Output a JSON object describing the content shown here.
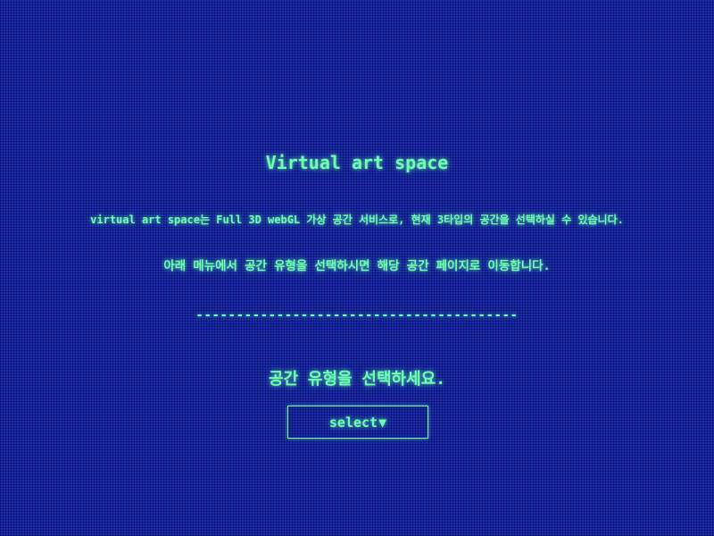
{
  "page": {
    "title": "Virtual art space",
    "description_line1": "virtual art space는 Full 3D webGL 가상 공간 서비스로, 현재 3타입의 공간을 선택하실 수 있습니다.",
    "description_line2": "아래 메뉴에서 공간 유형을 선택하시면 해당 공간 페이지로 이동합니다.",
    "divider": "----------------------------------------",
    "prompt": "공간 유형을 선택하세요."
  },
  "select": {
    "label": "select",
    "icon": "caret-down-icon",
    "caret_glyph": "▼"
  },
  "colors": {
    "background": "#1a2bb0",
    "text": "#6dffb0"
  }
}
